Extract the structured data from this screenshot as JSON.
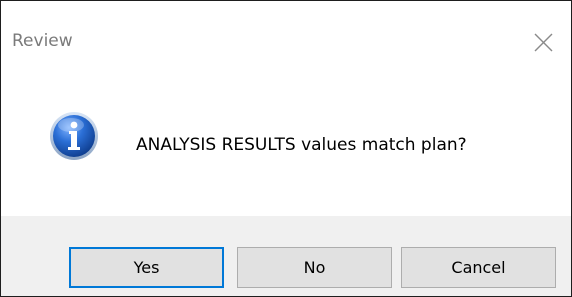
{
  "window": {
    "title": "Review",
    "close_icon": "close-icon"
  },
  "content": {
    "icon": "information-icon",
    "message": "ANALYSIS RESULTS values match plan?"
  },
  "buttons": {
    "yes_label": "Yes",
    "no_label": "No",
    "cancel_label": "Cancel"
  },
  "colors": {
    "accent": "#0078d7",
    "icon_blue": "#1565c0",
    "background": "#f0f0f0"
  }
}
